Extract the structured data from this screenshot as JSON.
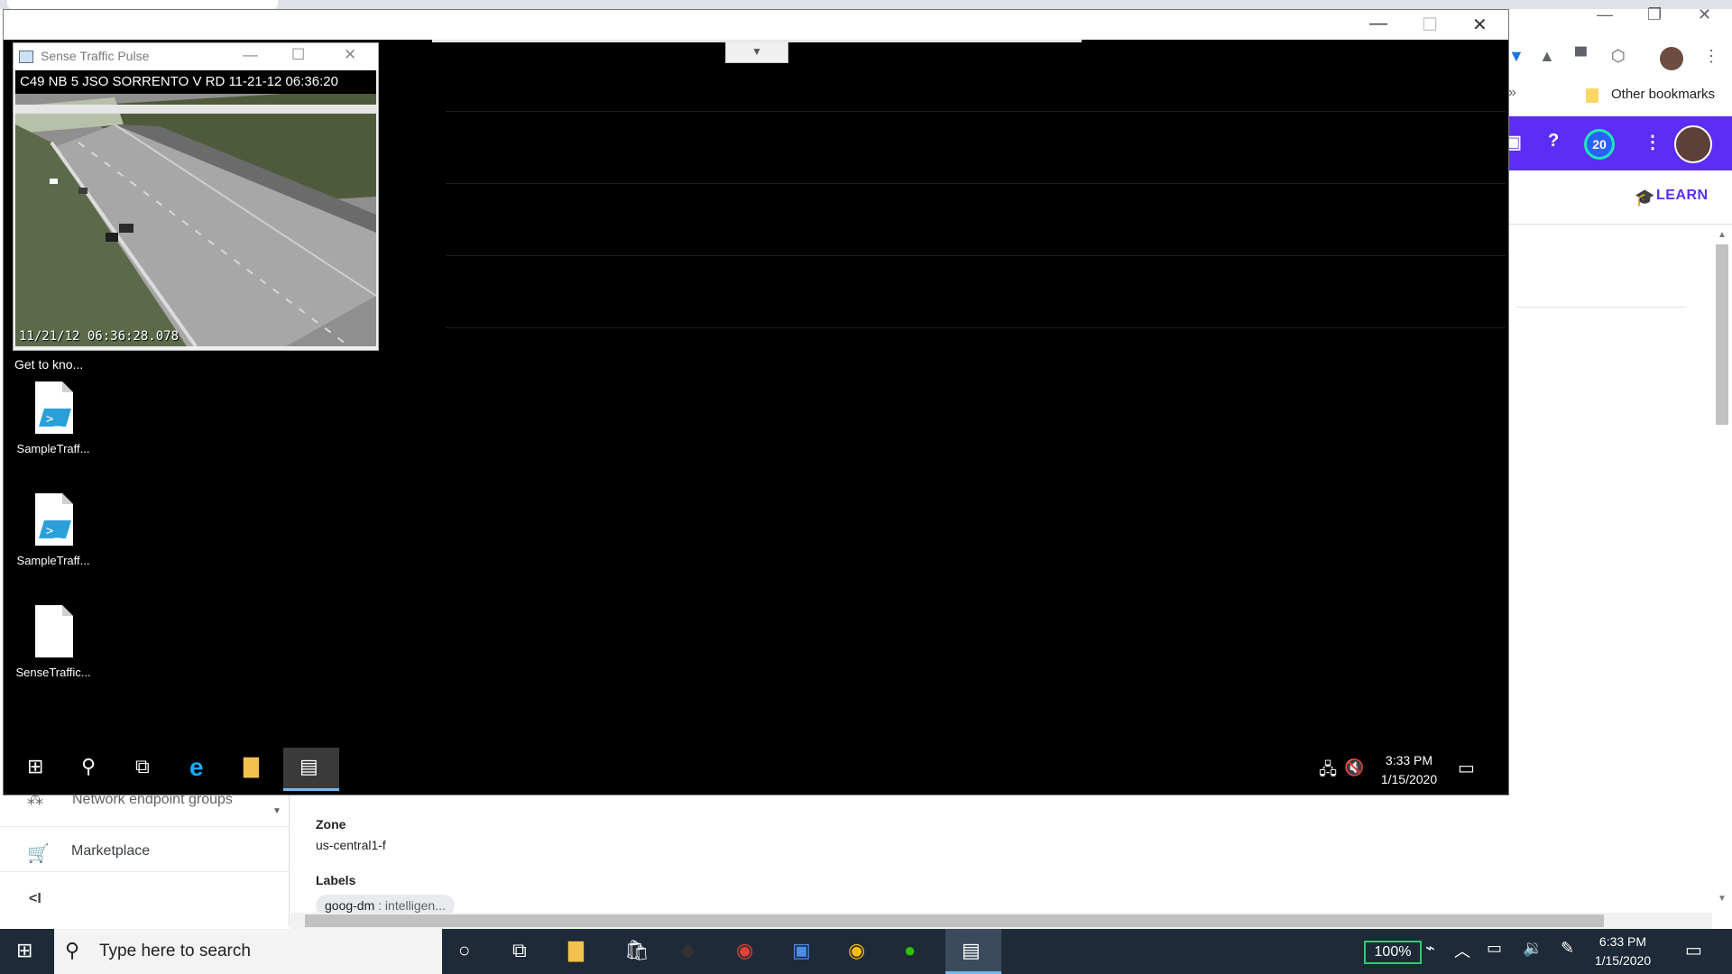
{
  "remote_window": {
    "traffic_pulse": {
      "title": "Sense Traffic Pulse",
      "camera_caption": "C49 NB 5 JSO SORRENTO V RD  11-21-12 06:36:20",
      "video_timestamp": "11/21/12 06:36:28.078"
    },
    "desktop_icons": [
      {
        "label": "Get to kno..."
      },
      {
        "label": "SampleTraff..."
      },
      {
        "label": "SampleTraff..."
      },
      {
        "label": "SenseTraffic..."
      }
    ],
    "taskbar": {
      "time": "3:33 PM",
      "date": "1/15/2020"
    }
  },
  "browser": {
    "bookmarks": {
      "chevron": "»",
      "other_bookmarks": "Other bookmarks"
    },
    "notification_count": "20",
    "learn_label": "LEARN",
    "accent_color": "#5b2df5"
  },
  "gcp": {
    "sidebar": {
      "network_endpoint_groups": "Network endpoint groups",
      "marketplace": "Marketplace",
      "collapse": "<I"
    },
    "zone_label": "Zone",
    "zone_value": "us-central1-f",
    "labels_label": "Labels",
    "chip_key": "goog-dm",
    "chip_value": " : intelligen..."
  },
  "host_taskbar": {
    "search_placeholder": "Type here to search",
    "zoom": "100%",
    "time": "6:33 PM",
    "date": "1/15/2020"
  }
}
